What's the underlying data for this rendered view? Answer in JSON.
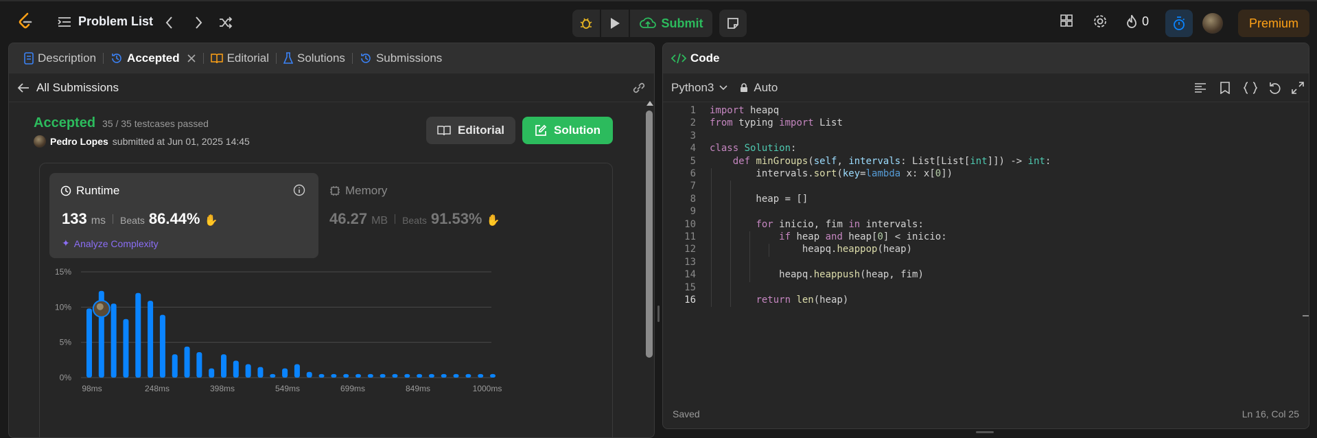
{
  "header": {
    "problem_list": "Problem List",
    "submit": "Submit",
    "streak": "0",
    "premium": "Premium"
  },
  "left": {
    "tabs": [
      "Description",
      "Accepted",
      "Editorial",
      "Solutions",
      "Submissions"
    ],
    "back": "All Submissions",
    "status": "Accepted",
    "testcases": "35 / 35 testcases passed",
    "user": "Pedro Lopes",
    "submitted": "submitted at Jun 01, 2025 14:45",
    "editorial_btn": "Editorial",
    "solution_btn": "Solution",
    "runtime": {
      "title": "Runtime",
      "value": "133",
      "unit": "ms",
      "beats_label": "Beats",
      "beats": "86.44%"
    },
    "memory": {
      "title": "Memory",
      "value": "46.27",
      "unit": "MB",
      "beats_label": "Beats",
      "beats": "91.53%"
    },
    "analyze": "Analyze Complexity"
  },
  "chart_data": {
    "type": "bar",
    "ylim": [
      0,
      15
    ],
    "yticks": [
      "15%",
      "10%",
      "5%",
      "0%"
    ],
    "xticks": [
      "98ms",
      "248ms",
      "398ms",
      "549ms",
      "699ms",
      "849ms",
      "1000ms"
    ],
    "values": [
      9.8,
      12.3,
      10.5,
      8.3,
      12.0,
      10.9,
      8.9,
      3.3,
      4.4,
      3.6,
      1.3,
      3.3,
      2.4,
      1.9,
      1.5,
      0.5,
      1.3,
      1.9,
      0.8,
      0.5,
      0.5,
      0.5,
      0.5,
      0.5,
      0.5,
      0.5,
      0.5,
      0.5,
      0.5,
      0.5,
      0.5,
      0.5,
      0.5,
      0.5
    ],
    "highlight_index": 1
  },
  "right": {
    "title": "Code",
    "language": "Python3",
    "auto": "Auto",
    "status": "Saved",
    "cursor": "Ln 16, Col 25",
    "lines": [
      [
        {
          "t": "import",
          "c": "kw"
        },
        {
          "t": " heapq"
        }
      ],
      [
        {
          "t": "from",
          "c": "kw"
        },
        {
          "t": " typing "
        },
        {
          "t": "import",
          "c": "kw"
        },
        {
          "t": " List"
        }
      ],
      [],
      [
        {
          "t": "class",
          "c": "kw"
        },
        {
          "t": " "
        },
        {
          "t": "Solution",
          "c": "ty"
        },
        {
          "t": ":"
        }
      ],
      [
        {
          "t": "    "
        },
        {
          "t": "def",
          "c": "kw"
        },
        {
          "t": " "
        },
        {
          "t": "minGroups",
          "c": "fn"
        },
        {
          "t": "("
        },
        {
          "t": "self",
          "c": "pm"
        },
        {
          "t": ", "
        },
        {
          "t": "intervals",
          "c": "pm"
        },
        {
          "t": ": List[List["
        },
        {
          "t": "int",
          "c": "ty"
        },
        {
          "t": "]]) -> "
        },
        {
          "t": "int",
          "c": "ty"
        },
        {
          "t": ":"
        }
      ],
      [
        {
          "t": "        intervals."
        },
        {
          "t": "sort",
          "c": "fn"
        },
        {
          "t": "("
        },
        {
          "t": "key",
          "c": "pm"
        },
        {
          "t": "="
        },
        {
          "t": "lambda",
          "c": "bl"
        },
        {
          "t": " x: x["
        },
        {
          "t": "0",
          "c": "nu"
        },
        {
          "t": "])"
        }
      ],
      [],
      [
        {
          "t": "        heap = []"
        }
      ],
      [],
      [
        {
          "t": "        "
        },
        {
          "t": "for",
          "c": "kw"
        },
        {
          "t": " inicio, fim "
        },
        {
          "t": "in",
          "c": "kw"
        },
        {
          "t": " intervals:"
        }
      ],
      [
        {
          "t": "            "
        },
        {
          "t": "if",
          "c": "kw"
        },
        {
          "t": " heap "
        },
        {
          "t": "and",
          "c": "kw"
        },
        {
          "t": " heap["
        },
        {
          "t": "0",
          "c": "nu"
        },
        {
          "t": "] < inicio:"
        }
      ],
      [
        {
          "t": "                heapq."
        },
        {
          "t": "heappop",
          "c": "fn"
        },
        {
          "t": "(heap)"
        }
      ],
      [],
      [
        {
          "t": "            heapq."
        },
        {
          "t": "heappush",
          "c": "fn"
        },
        {
          "t": "(heap, fim)"
        }
      ],
      [],
      [
        {
          "t": "        "
        },
        {
          "t": "return",
          "c": "kw"
        },
        {
          "t": " "
        },
        {
          "t": "len",
          "c": "fn"
        },
        {
          "t": "(heap)"
        }
      ]
    ]
  }
}
